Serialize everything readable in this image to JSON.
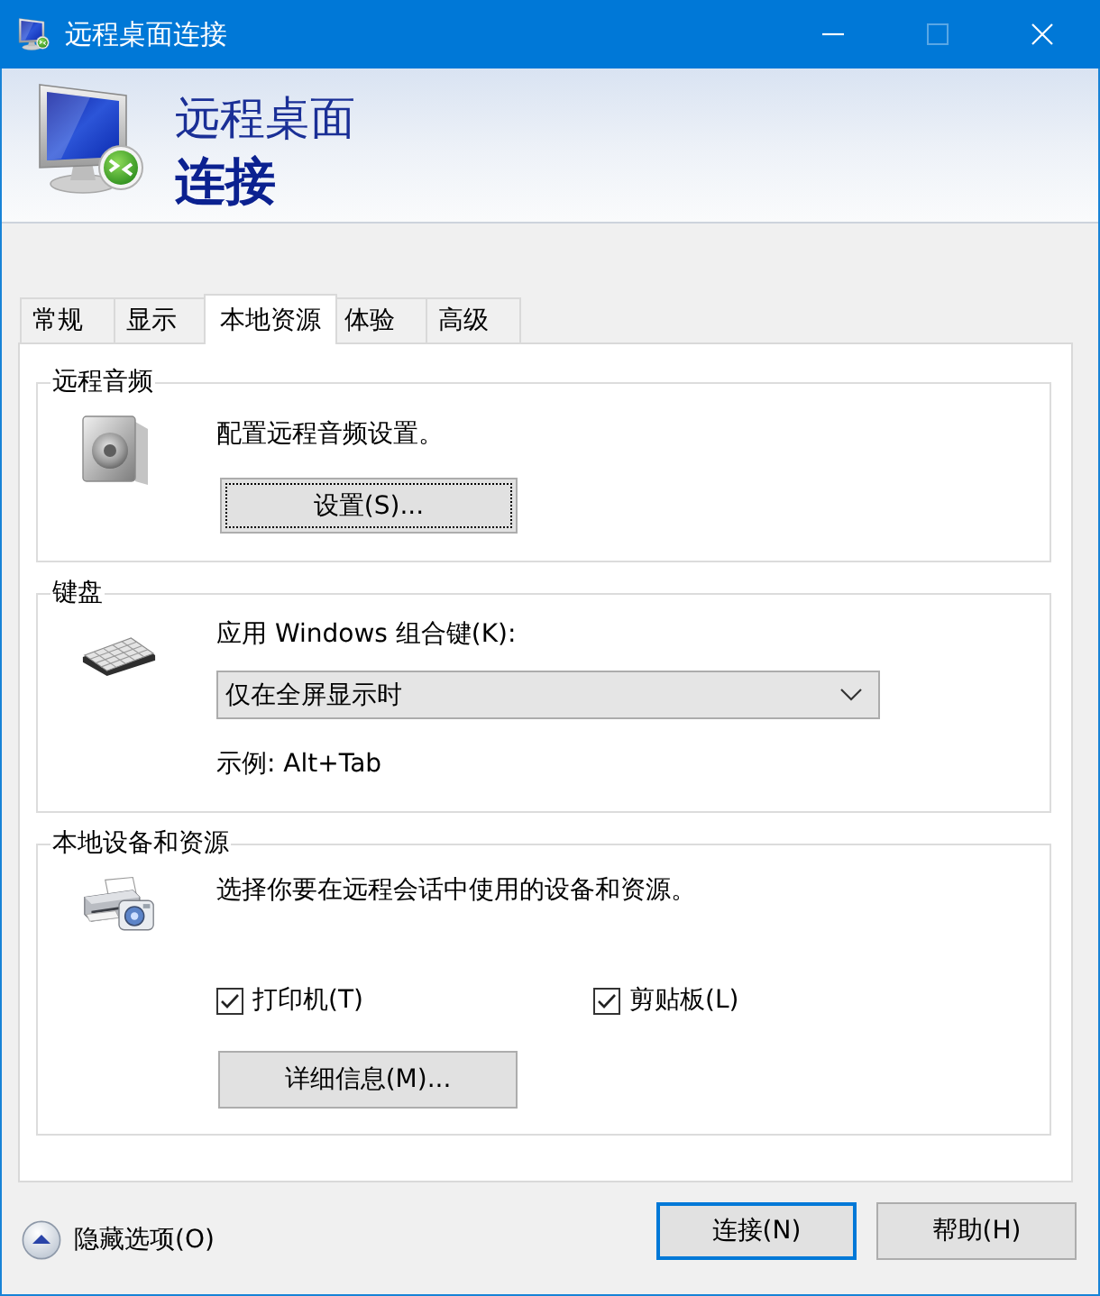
{
  "window": {
    "title": "远程桌面连接",
    "maximize_disabled": true
  },
  "banner": {
    "line_1": "远程桌面",
    "line_2": "连接"
  },
  "tabs": [
    {
      "label": "常规",
      "selected": false
    },
    {
      "label": "显示",
      "selected": false
    },
    {
      "label": "本地资源",
      "selected": true
    },
    {
      "label": "体验",
      "selected": false
    },
    {
      "label": "高级",
      "selected": false
    }
  ],
  "groups": [
    {
      "kind": "audio",
      "legend": "远程音频",
      "description": "配置远程音频设置。",
      "button": {
        "label": "设置(S)...",
        "focused": true
      }
    },
    {
      "kind": "keyboard",
      "legend": "键盘",
      "field_label": "应用 Windows 组合键(K):",
      "select_value": "仅在全屏显示时",
      "example": "示例: Alt+Tab"
    },
    {
      "kind": "devices",
      "legend": "本地设备和资源",
      "description": "选择你要在远程会话中使用的设备和资源。",
      "checkboxes": [
        {
          "label": "打印机(T)",
          "checked": true
        },
        {
          "label": "剪贴板(L)",
          "checked": true
        }
      ],
      "button": {
        "label": "详细信息(M)...",
        "focused": false
      }
    }
  ],
  "footer": {
    "toggle": {
      "label": "隐藏选项(O)",
      "expanded": true
    },
    "buttons": [
      {
        "label": "连接(N)",
        "default": true
      },
      {
        "label": "帮助(H)",
        "default": false
      }
    ]
  }
}
